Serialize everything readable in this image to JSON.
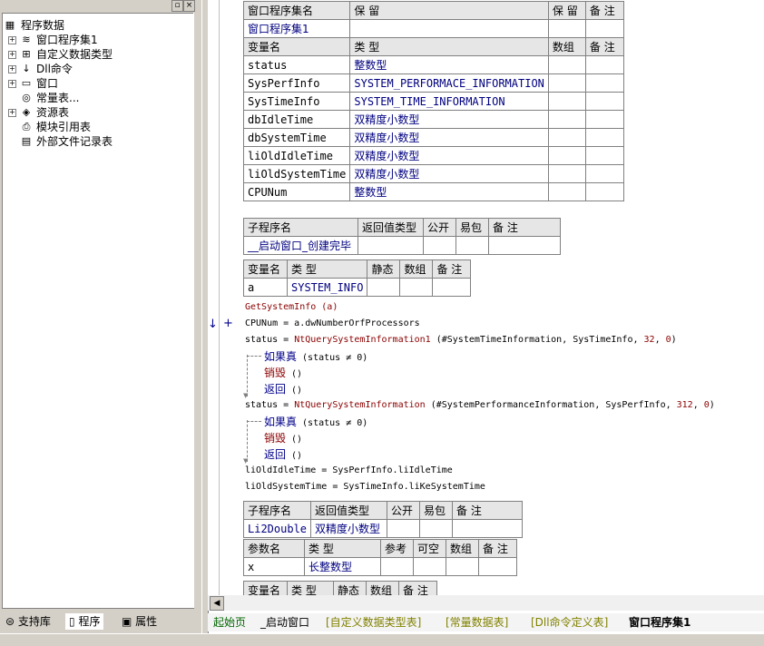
{
  "left_panel": {
    "tree": [
      {
        "label": "程序数据",
        "icon": "program-data-icon"
      },
      {
        "label": "窗口程序集1",
        "icon": "assembly-icon"
      },
      {
        "label": "自定义数据类型",
        "icon": "datatype-icon"
      },
      {
        "label": "Dll命令",
        "icon": "dll-icon"
      },
      {
        "label": "窗口",
        "icon": "window-icon"
      },
      {
        "label": "常量表...",
        "icon": "constant-icon"
      },
      {
        "label": "资源表",
        "icon": "resource-icon"
      },
      {
        "label": "模块引用表",
        "icon": "module-icon"
      },
      {
        "label": "外部文件记录表",
        "icon": "external-file-icon"
      }
    ],
    "tabs": [
      "支持库",
      "程序",
      "属性"
    ]
  },
  "assembly_table": {
    "headers": [
      "窗口程序集名",
      "保 留",
      "保 留",
      "备 注"
    ],
    "name": "窗口程序集1",
    "var_headers": [
      "变量名",
      "类 型",
      "数组",
      "备 注"
    ],
    "vars": [
      {
        "name": "status",
        "type": "整数型"
      },
      {
        "name": "SysPerfInfo",
        "type": "SYSTEM_PERFORMACE_INFORMATION"
      },
      {
        "name": "SysTimeInfo",
        "type": "SYSTEM_TIME_INFORMATION"
      },
      {
        "name": "dbIdleTime",
        "type": "双精度小数型"
      },
      {
        "name": "dbSystemTime",
        "type": "双精度小数型"
      },
      {
        "name": "liOldIdleTime",
        "type": "双精度小数型"
      },
      {
        "name": "liOldSystemTime",
        "type": "双精度小数型"
      },
      {
        "name": "CPUNum",
        "type": "整数型"
      }
    ]
  },
  "sub1": {
    "headers": [
      "子程序名",
      "返回值类型",
      "公开",
      "易包",
      "备 注"
    ],
    "name": "__启动窗口_创建完毕",
    "local_headers": [
      "变量名",
      "类 型",
      "静态",
      "数组",
      "备 注"
    ],
    "local": {
      "name": "a",
      "type": "SYSTEM_INFO"
    }
  },
  "code": {
    "l1": "GetSystemInfo (a)",
    "l2": "CPUNum = a.dwNumberOrfProcessors",
    "l3a": "status = ",
    "l3fn": "NtQuerySystemInformation1",
    "l3b": " (#SystemTimeInformation, SysTimeInfo, ",
    "l3n1": "32",
    "l3c": ", ",
    "l3n2": "0",
    "l3d": ")",
    "if1_kw": "如果真",
    "if1_cond": " (status ≠ 0)",
    "destroy": "销毁",
    "destroy_args": " ()",
    "ret": "返回",
    "ret_args": " ()",
    "l4a": "status = ",
    "l4fn": "NtQuerySystemInformation",
    "l4b": " (#SystemPerformanceInformation, SysPerfInfo, ",
    "l4n1": "312",
    "l4c": ", ",
    "l4n2": "0",
    "l4d": ")",
    "l5": "liOldIdleTime = SysPerfInfo.liIdleTime",
    "l6": "liOldSystemTime = SysTimeInfo.liKeSystemTime",
    "gutter_arrow": "↓",
    "gutter_plus": "+"
  },
  "sub2": {
    "headers": [
      "子程序名",
      "返回值类型",
      "公开",
      "易包",
      "备 注"
    ],
    "name": "Li2Double",
    "ret_type": "双精度小数型",
    "param_headers": [
      "参数名",
      "类 型",
      "参考",
      "可空",
      "数组",
      "备 注"
    ],
    "param": {
      "name": "x",
      "type": "长整数型"
    },
    "local_headers": [
      "变量名",
      "类 型",
      "静态",
      "数组",
      "备 注"
    ]
  },
  "bottom_tabs": [
    "起始页",
    "_启动窗口",
    "[自定义数据类型表]",
    "[常量数据表]",
    "[Dll命令定义表]",
    "窗口程序集1"
  ],
  "colors": {
    "tab_active_start": "#006400",
    "tab_bracket": "#808000",
    "link_blue": "#00008b",
    "fn_red": "#8b0000"
  }
}
